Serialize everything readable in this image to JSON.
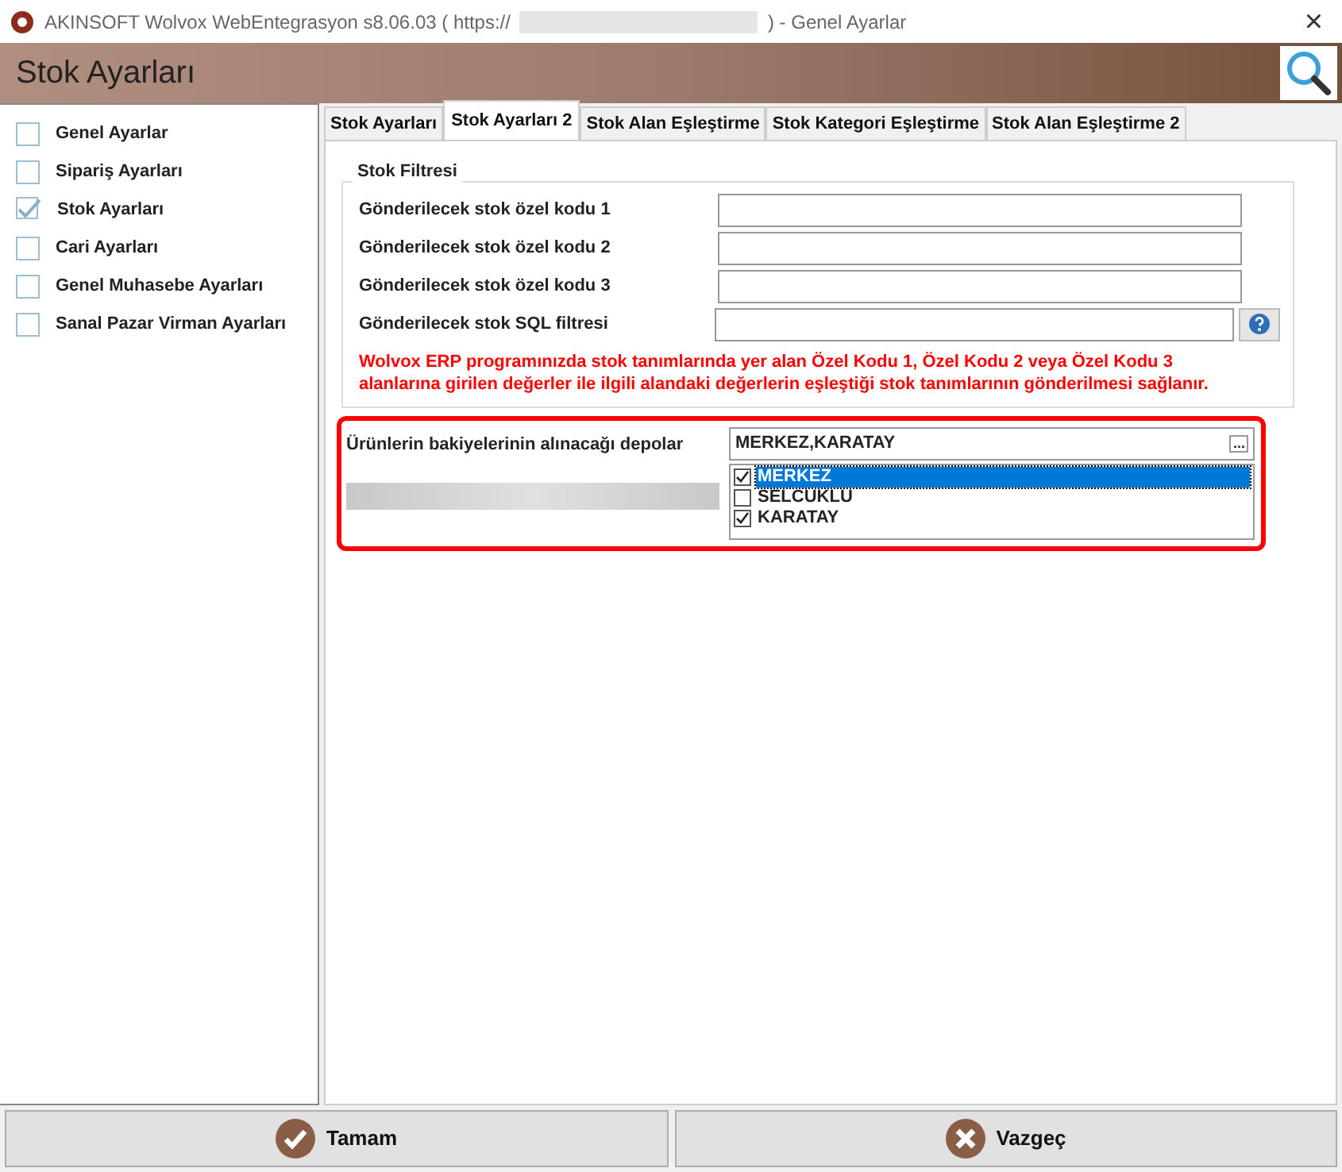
{
  "window": {
    "title_start": "AKINSOFT Wolvox WebEntegrasyon s8.06.03 ( https://",
    "title_end": ")  - Genel Ayarlar",
    "close": "×"
  },
  "header": {
    "title": "Stok Ayarları"
  },
  "sidebar": {
    "items": [
      {
        "label": "Genel Ayarlar",
        "checked": false
      },
      {
        "label": "Sipariş Ayarları",
        "checked": false
      },
      {
        "label": "Stok Ayarları",
        "checked": true
      },
      {
        "label": "Cari Ayarları",
        "checked": false
      },
      {
        "label": "Genel Muhasebe Ayarları",
        "checked": false
      },
      {
        "label": "Sanal Pazar Virman Ayarları",
        "checked": false
      }
    ]
  },
  "tabs": [
    {
      "label": "Stok Ayarları",
      "selected": false
    },
    {
      "label": "Stok Ayarları 2",
      "selected": true
    },
    {
      "label": "Stok Alan Eşleştirme",
      "selected": false
    },
    {
      "label": "Stok Kategori Eşleştirme",
      "selected": false
    },
    {
      "label": "Stok Alan Eşleştirme 2",
      "selected": false
    }
  ],
  "stock_filter": {
    "legend": "Stok Filtresi",
    "fields": [
      {
        "label": "Gönderilecek stok özel kodu 1",
        "kind": "text"
      },
      {
        "label": "Gönderilecek stok özel kodu 2",
        "kind": "text"
      },
      {
        "label": "Gönderilecek stok özel kodu 3",
        "kind": "text"
      },
      {
        "label": "Gönderilecek stok SQL filtresi",
        "kind": "help"
      }
    ],
    "note": "Wolvox ERP programınızda stok tanımlarında yer alan Özel Kodu 1, Özel Kodu 2 veya Özel Kodu 3 alanlarına girilen değerler ile ilgili alandaki değerlerin eşleştiği stok tanımlarının gönderilmesi sağlanır."
  },
  "warehouses": {
    "label": "Ürünlerin bakiyelerinin alınacağı depolar",
    "value": "MERKEZ,KARATAY",
    "ellipsis": "...",
    "options": [
      {
        "label": "MERKEZ",
        "checked": true,
        "selected": true
      },
      {
        "label": "SELCUKLU",
        "checked": false,
        "selected": false
      },
      {
        "label": "KARATAY",
        "checked": true,
        "selected": false
      }
    ]
  },
  "buttons": [
    {
      "label": "Tamam",
      "kind": "ok"
    },
    {
      "label": "Vazgeç",
      "kind": "cancel"
    }
  ]
}
